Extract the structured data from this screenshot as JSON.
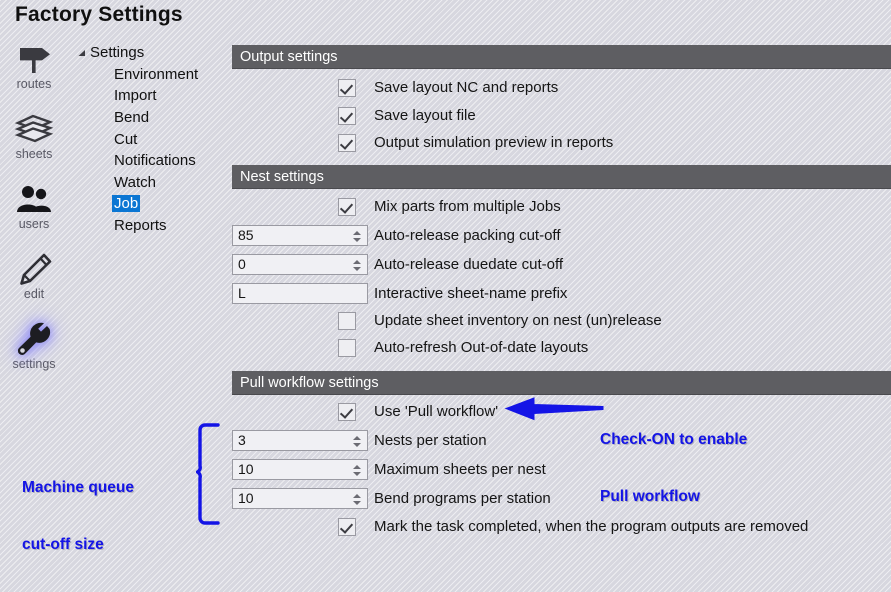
{
  "window": {
    "title": "Factory Settings"
  },
  "icon_rail": {
    "items": [
      {
        "label": "routes",
        "icon": "signpost-icon",
        "selected": false
      },
      {
        "label": "sheets",
        "icon": "stacked-sheets-icon",
        "selected": false
      },
      {
        "label": "users",
        "icon": "users-icon",
        "selected": false
      },
      {
        "label": "edit",
        "icon": "pencil-icon",
        "selected": false
      },
      {
        "label": "settings",
        "icon": "wrench-icon",
        "selected": true
      }
    ]
  },
  "tree": {
    "root": {
      "label": "Settings",
      "expanded": true,
      "caret": "expanded-caret-icon"
    },
    "children": [
      {
        "label": "Environment",
        "selected": false
      },
      {
        "label": "Import",
        "selected": false
      },
      {
        "label": "Bend",
        "selected": false
      },
      {
        "label": "Cut",
        "selected": false
      },
      {
        "label": "Notifications",
        "selected": false
      },
      {
        "label": "Watch",
        "selected": false
      },
      {
        "label": "Job",
        "selected": true
      },
      {
        "label": "Reports",
        "selected": false
      }
    ]
  },
  "sections": [
    {
      "title": "Output settings",
      "rows": [
        {
          "type": "checkbox",
          "checked": true,
          "label": "Save layout NC and reports"
        },
        {
          "type": "checkbox",
          "checked": true,
          "label": "Save layout file"
        },
        {
          "type": "checkbox",
          "checked": true,
          "label": "Output simulation preview in reports"
        }
      ]
    },
    {
      "title": "Nest settings",
      "rows": [
        {
          "type": "checkbox",
          "checked": true,
          "label": "Mix parts from multiple Jobs"
        },
        {
          "type": "spinner",
          "value": "85",
          "label": "Auto-release packing cut-off"
        },
        {
          "type": "spinner",
          "value": "0",
          "label": "Auto-release duedate cut-off"
        },
        {
          "type": "text",
          "value": "L",
          "label": "Interactive sheet-name prefix"
        },
        {
          "type": "checkbox",
          "checked": false,
          "label": "Update sheet inventory on nest (un)release"
        },
        {
          "type": "checkbox",
          "checked": false,
          "label": "Auto-refresh Out-of-date layouts"
        }
      ]
    },
    {
      "title": "Pull workflow settings",
      "rows": [
        {
          "type": "checkbox",
          "checked": true,
          "label": "Use 'Pull workflow'"
        },
        {
          "type": "spinner",
          "value": "3",
          "label": "Nests per station"
        },
        {
          "type": "spinner",
          "value": "10",
          "label": "Maximum sheets per nest"
        },
        {
          "type": "spinner",
          "value": "10",
          "label": "Bend programs per station"
        },
        {
          "type": "checkbox",
          "checked": true,
          "label": "Mark the task completed, when the program outputs are removed"
        }
      ]
    }
  ],
  "annotations": {
    "right_note": {
      "line1": "Check-ON to enable",
      "line2": "Pull workflow",
      "color": "#1414e6",
      "arrow": "left-arrow-annotation"
    },
    "left_note": {
      "line1": "Machine queue",
      "line2": "cut-off size",
      "color": "#1414e6",
      "brace": "curly-brace-annotation"
    }
  }
}
